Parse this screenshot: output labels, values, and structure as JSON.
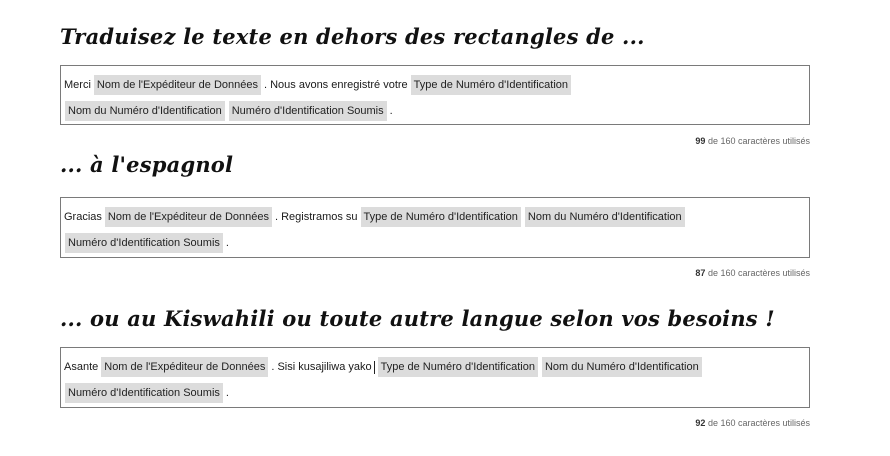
{
  "section1": {
    "heading": "Traduisez le texte en dehors des rectangles de ...",
    "line1": {
      "t1": "Merci",
      "c1": "Nom de l'Expéditeur de Données",
      "t2": ". Nous avons enregistré votre",
      "c2": "Type de Numéro d'Identification"
    },
    "line2": {
      "c3": "Nom du Numéro d'Identification",
      "c4": "Numéro d'Identification Soumis",
      "t3": "."
    },
    "counter": {
      "count": "99",
      "suffix": "de 160 caractères utilisés"
    }
  },
  "section2": {
    "heading": "... à l'espagnol",
    "line1": {
      "t1": "Gracias",
      "c1": "Nom de l'Expéditeur de Données",
      "t2": ". Registramos su",
      "c2": "Type de Numéro d'Identification",
      "c3": "Nom du Numéro d'Identification"
    },
    "line2": {
      "c4": "Numéro d'Identification Soumis",
      "t3": "."
    },
    "counter": {
      "count": "87",
      "suffix": "de 160 caractères utilisés"
    }
  },
  "section3": {
    "heading": "... ou au Kiswahili ou toute autre langue selon vos besoins !",
    "line1": {
      "t1": "Asante",
      "c1": "Nom de l'Expéditeur de Données",
      "t2": ". Sisi kusajiliwa yako",
      "c2": "Type de Numéro d'Identification",
      "c3": "Nom du Numéro d'Identification"
    },
    "line2": {
      "c4": "Numéro d'Identification Soumis",
      "t3": "."
    },
    "counter": {
      "count": "92",
      "suffix": "de 160 caractères utilisés"
    }
  }
}
